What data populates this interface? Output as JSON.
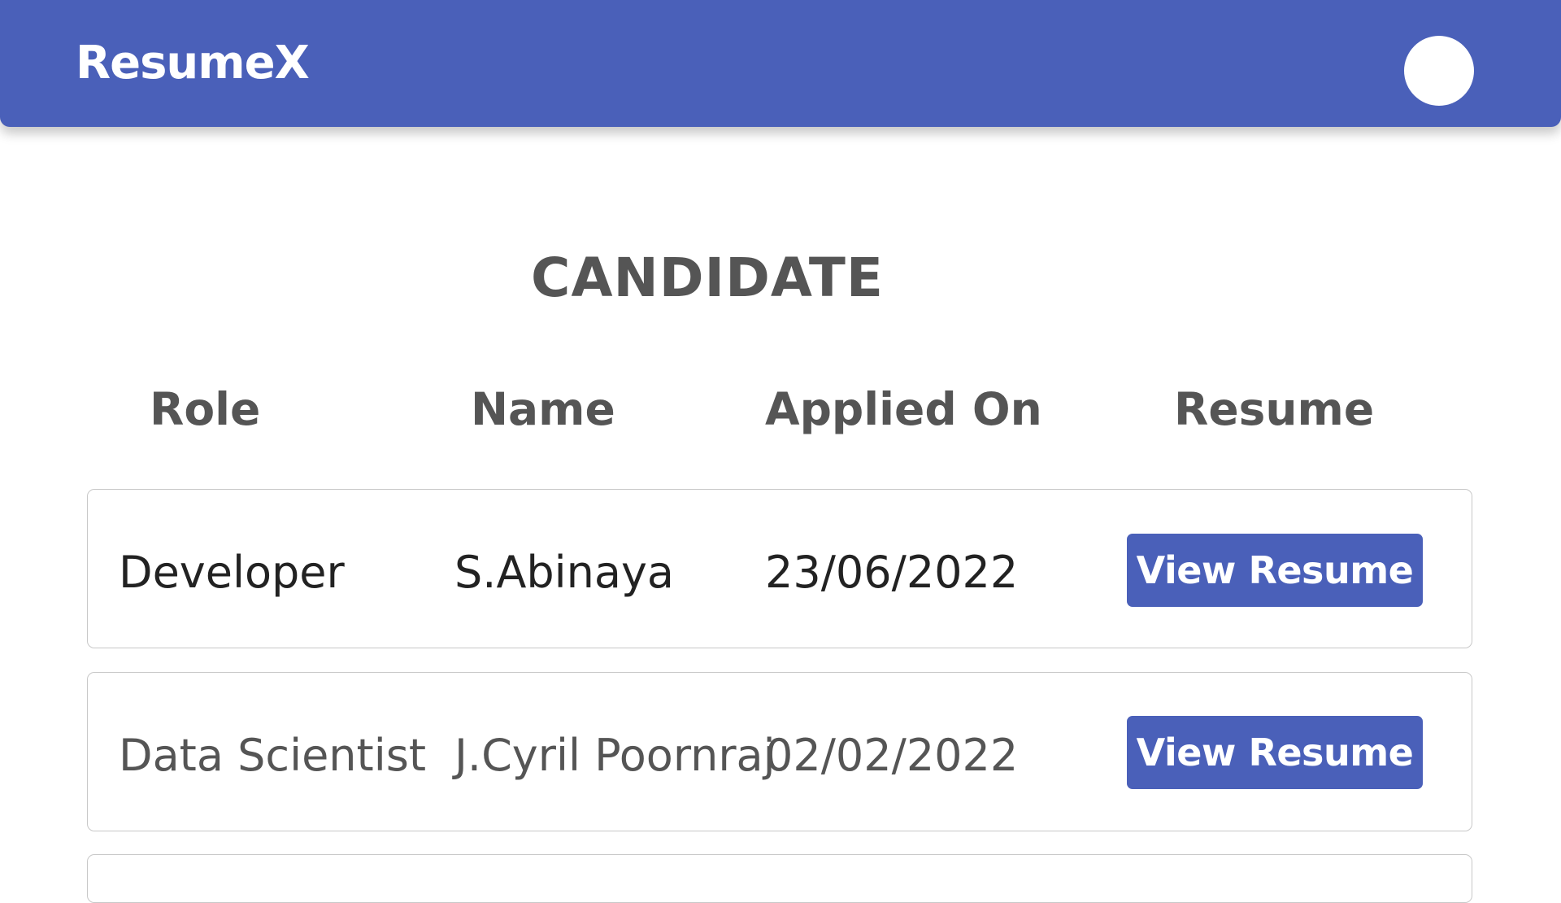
{
  "app": {
    "title": "ResumeX",
    "avatar_icon": "user-avatar-circle"
  },
  "page": {
    "title": "CANDIDATE"
  },
  "table": {
    "headers": [
      "Role",
      "Name",
      "Applied On",
      "Resume"
    ],
    "rows": [
      {
        "role": "Developer",
        "name": "S.Abinaya",
        "applied_on": "23/06/2022",
        "action": "View Resume"
      },
      {
        "role": "Data Scientist",
        "name": "J.Cyril Poornraj",
        "applied_on": "02/02/2022",
        "action": "View Resume"
      }
    ]
  },
  "colors": {
    "primary": "#4a60b9",
    "heading_text": "#555555",
    "body_text": "#222222",
    "border": "#c8c8c8"
  }
}
